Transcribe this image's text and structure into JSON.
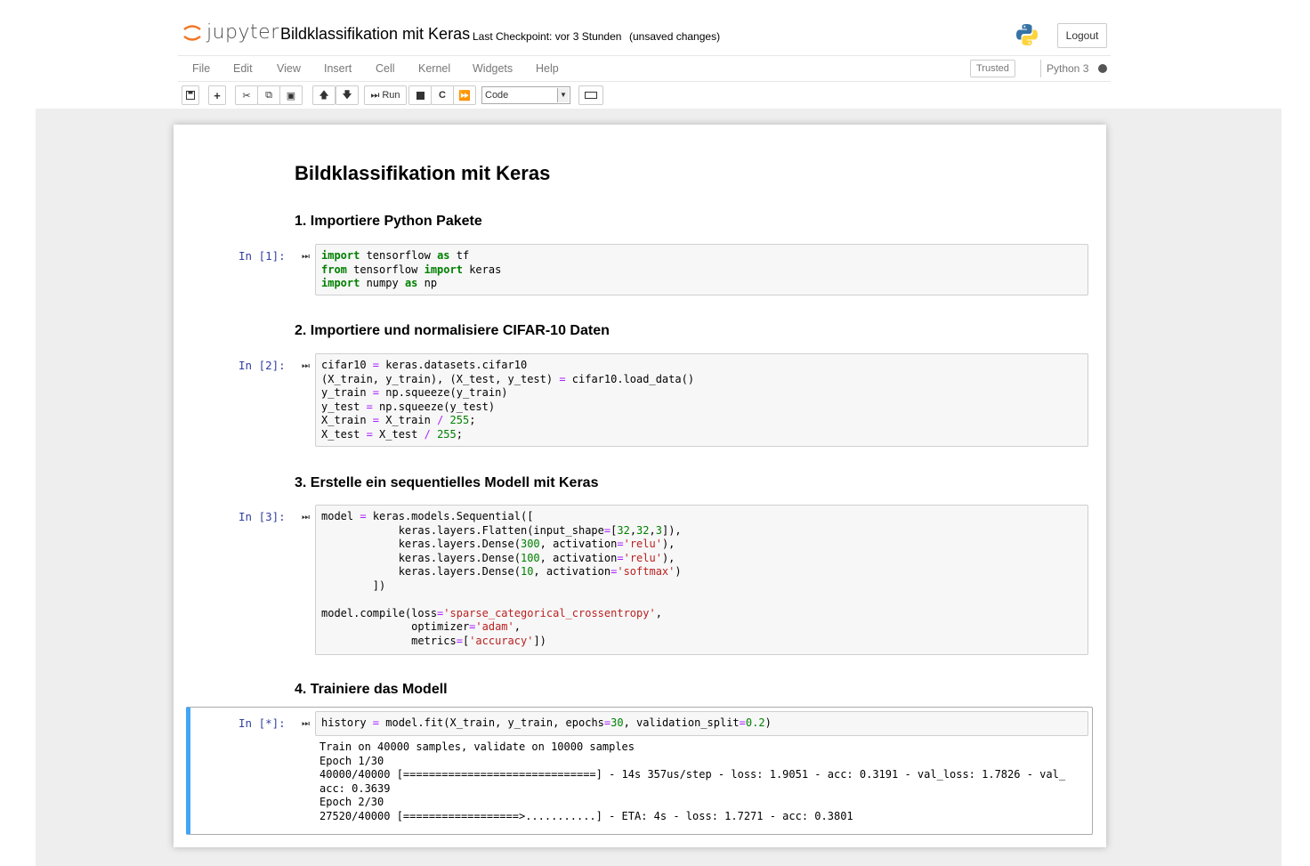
{
  "header": {
    "logo_text": "jupyter",
    "notebook_title": "Bildklassifikation mit Keras",
    "checkpoint": "Last Checkpoint: vor 3 Stunden",
    "autosave_status": "(unsaved changes)",
    "logout_label": "Logout"
  },
  "menubar": {
    "items": [
      "File",
      "Edit",
      "View",
      "Insert",
      "Cell",
      "Kernel",
      "Widgets",
      "Help"
    ],
    "trusted_label": "Trusted",
    "kernel_name": "Python 3"
  },
  "toolbar": {
    "run_label": "Run",
    "cell_type": "Code",
    "buttons": [
      "save-icon",
      "add-cell-icon",
      "cut-icon",
      "copy-icon",
      "paste-icon",
      "move-up-icon",
      "move-down-icon",
      "run-icon",
      "stop-icon",
      "restart-icon",
      "fast-forward-icon",
      "keyboard-icon"
    ]
  },
  "notebook": {
    "title": "Bildklassifikation mit Keras",
    "headings": [
      "1. Importiere Python Pakete",
      "2. Importiere und normalisiere CIFAR-10 Daten",
      "3. Erstelle ein sequentielles Modell mit Keras",
      "4. Trainiere das Modell"
    ],
    "prompts": [
      "In [1]:",
      "In [2]:",
      "In [3]:",
      "In [*]:"
    ],
    "output_text": "Train on 40000 samples, validate on 10000 samples\nEpoch 1/30\n40000/40000 [==============================] - 14s 357us/step - loss: 1.9051 - acc: 0.3191 - val_loss: 1.7826 - val_\nacc: 0.3639\nEpoch 2/30\n27520/40000 [==================>...........] - ETA: 4s - loss: 1.7271 - acc: 0.3801"
  },
  "colors": {
    "prompt": "#303f9f",
    "keyword": "#008000",
    "string": "#ba2121",
    "operator": "#aa22ff",
    "selected_cell_border": "#42a5f5",
    "site_background": "#eeeeee"
  }
}
